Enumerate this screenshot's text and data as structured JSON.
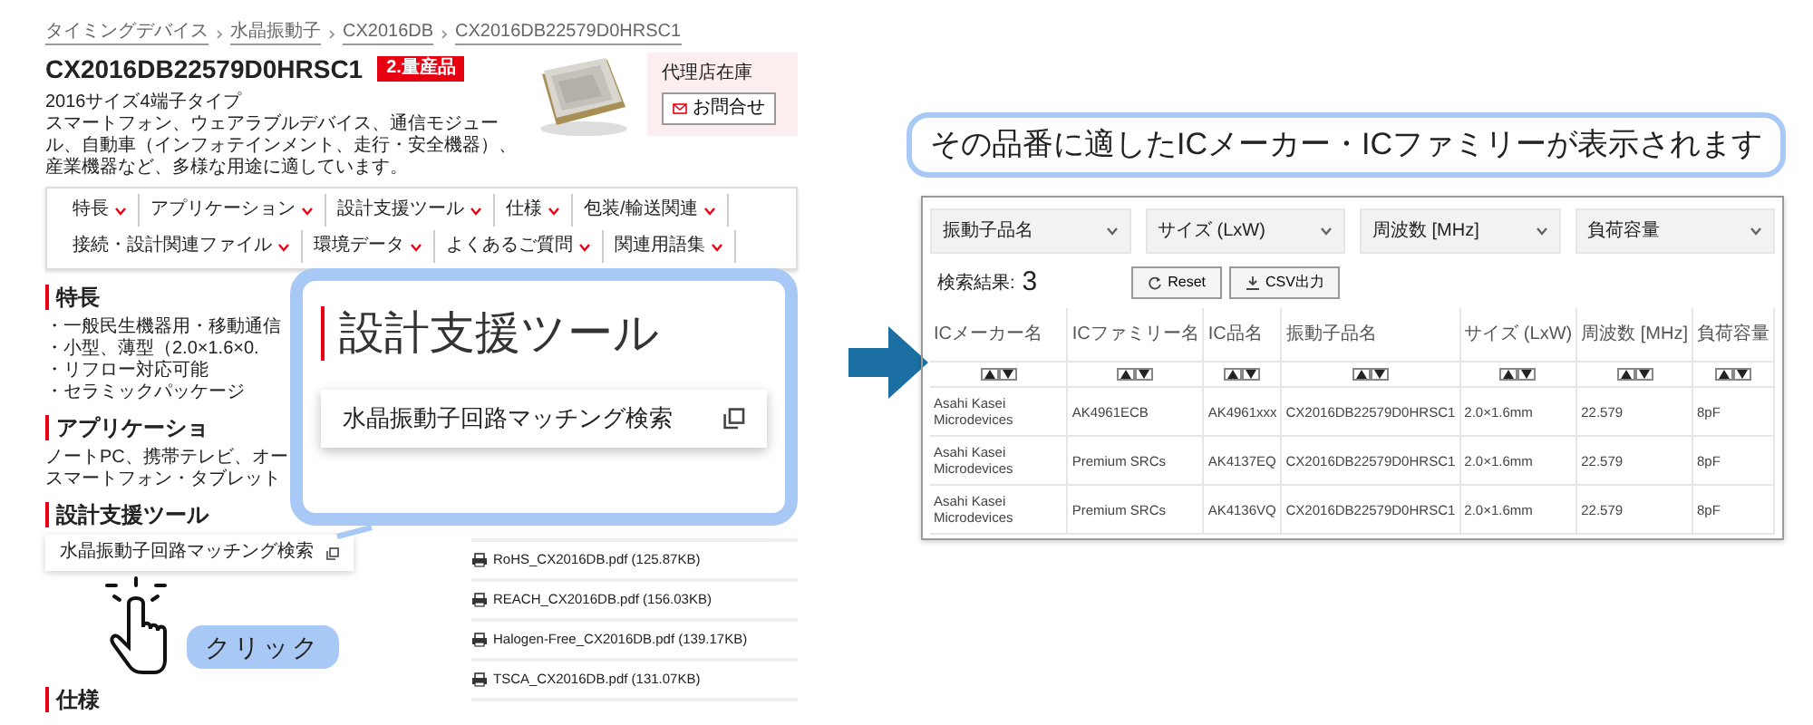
{
  "left_page": {
    "breadcrumb": [
      "タイミングデバイス",
      "水晶振動子",
      "CX2016DB",
      "CX2016DB22579D0HRSC1"
    ],
    "title": "CX2016DB22579D0HRSC1",
    "badge": "2.量産品",
    "description": [
      "2016サイズ4端子タイプ",
      "スマートフォン、ウェアラブルデバイス、通信モジュール、自動車（インフォテインメント、走行・安全機器）、産業機器など、多様な用途に適しています。"
    ],
    "stock_panel": {
      "label": "代理店在庫",
      "button": "お問合せ"
    },
    "nav": [
      "特長",
      "アプリケーション",
      "設計支援ツール",
      "仕様",
      "包装/輸送関連",
      "接続・設計関連ファイル",
      "環境データ",
      "よくあるご質問",
      "関連用語集"
    ],
    "sections": [
      {
        "heading": "特長",
        "lines": [
          "・一般民生機器用・移動通信",
          "・小型、薄型（2.0×1.6×0.",
          "・リフロー対応可能",
          "・セラミックパッケージ"
        ]
      },
      {
        "heading": "アプリケーショ",
        "lines": [
          "ノートPC、携帯テレビ、オー",
          "スマートフォン・タブレット"
        ]
      },
      {
        "heading": "設計支援ツール",
        "tool": "水晶振動子回路マッチング検索"
      },
      {
        "heading": "仕様"
      }
    ],
    "files": [
      "RoHS_CX2016DB.pdf (125.87KB)",
      "REACH_CX2016DB.pdf (156.03KB)",
      "Halogen-Free_CX2016DB.pdf (139.17KB)",
      "TSCA_CX2016DB.pdf (131.07KB)"
    ]
  },
  "callout": {
    "heading": "設計支援ツール",
    "tool": "水晶振動子回路マッチング検索"
  },
  "click_label": "クリック",
  "result_bubble": "その品番に適したICメーカー・ICファミリーが表示されます",
  "result_panel": {
    "filters": [
      "振動子品名",
      "サイズ (LxW)",
      "周波数 [MHz]",
      "負荷容量"
    ],
    "result_label": "検索結果:",
    "result_count": "3",
    "buttons": [
      "Reset",
      "CSV出力"
    ],
    "columns": [
      "ICメーカー名",
      "ICファミリー名",
      "IC品名",
      "振動子品名",
      "サイズ (LxW)",
      "周波数 [MHz]",
      "負荷容量"
    ],
    "rows": [
      [
        "Asahi Kasei Microdevices",
        "AK4961ECB",
        "AK4961xxx",
        "CX2016DB22579D0HRSC1",
        "2.0×1.6mm",
        "22.579",
        "8pF"
      ],
      [
        "Asahi Kasei Microdevices",
        "Premium SRCs",
        "AK4137EQ",
        "CX2016DB22579D0HRSC1",
        "2.0×1.6mm",
        "22.579",
        "8pF"
      ],
      [
        "Asahi Kasei Microdevices",
        "Premium SRCs",
        "AK4136VQ",
        "CX2016DB22579D0HRSC1",
        "2.0×1.6mm",
        "22.579",
        "8pF"
      ]
    ]
  }
}
